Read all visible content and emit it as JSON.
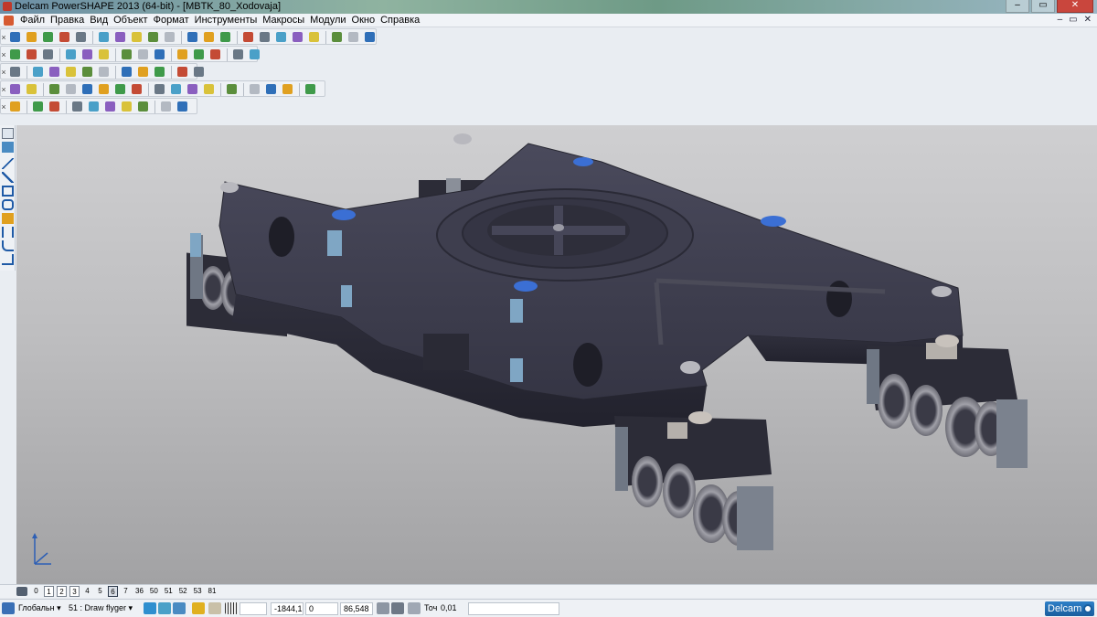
{
  "window": {
    "title": "Delcam PowerSHAPE 2013 (64-bit) - [MBTK_80_Xodovaja]"
  },
  "menu": {
    "items": [
      "Файл",
      "Правка",
      "Вид",
      "Объект",
      "Формат",
      "Инструменты",
      "Макросы",
      "Модули",
      "Окно",
      "Справка"
    ]
  },
  "layers": {
    "items": [
      "0",
      "1",
      "2",
      "3",
      "4",
      "5",
      "6",
      "7",
      "36",
      "50",
      "51",
      "52",
      "53",
      "81"
    ],
    "boxed": [
      "1",
      "2",
      "3"
    ],
    "active": "6"
  },
  "statusbar": {
    "workplane": "Глобальн",
    "level": "51 : Draw flyger",
    "x": "-1844,1",
    "y": "0",
    "z": "86,548",
    "tolerance_label": "Точ",
    "tolerance": "0,01",
    "brand": "Delcam"
  },
  "colors": {
    "chassis": "#3c3c4c",
    "accent_blue": "#3b6fd4",
    "accent_steel": "#7fa6c4",
    "viewport_top": "#cfcfd1",
    "viewport_bottom": "#a2a2a4"
  }
}
